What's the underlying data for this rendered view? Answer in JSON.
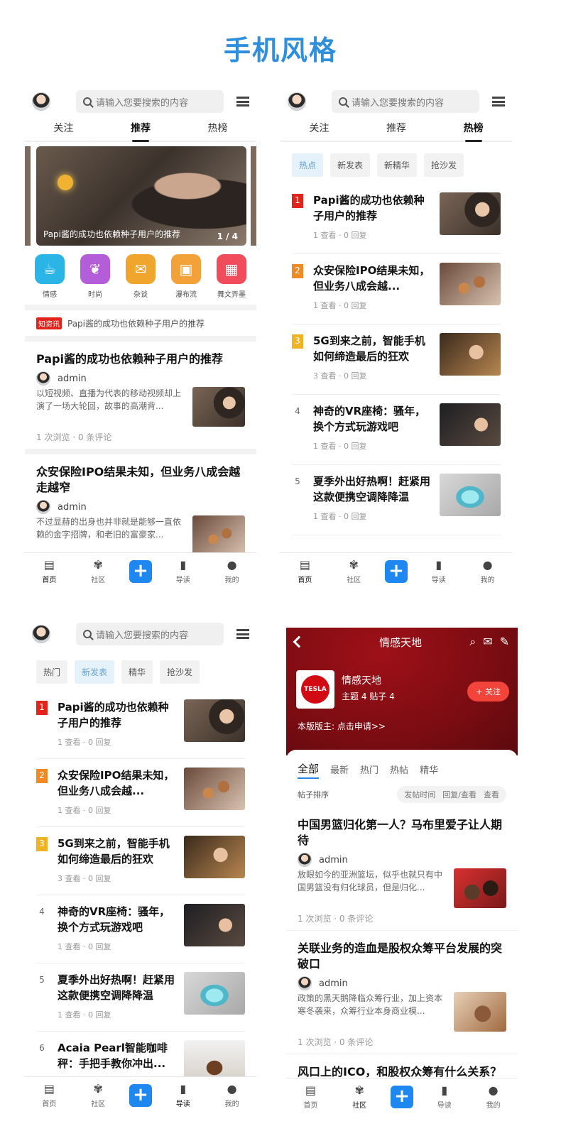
{
  "title": "手机风格",
  "common": {
    "search_placeholder": "请输入您要搜索的内容",
    "tabs": [
      "关注",
      "推荐",
      "热榜"
    ],
    "nav": [
      "首页",
      "社区",
      "导读",
      "我的"
    ],
    "nav_add": "+"
  },
  "phone1": {
    "banner_caption": "Papi酱的成功也依赖种子用户的推荐",
    "banner_page": "1 / 4",
    "categories": [
      "情感",
      "时尚",
      "杂谈",
      "瀑布流",
      "舞文弄墨"
    ],
    "notice_badge": "知资讯",
    "notice_text": "Papi酱的成功也依赖种子用户的推荐",
    "feeds": [
      {
        "title": "Papi酱的成功也依赖种子用户的推荐",
        "author": "admin",
        "excerpt": "以短视频、直播为代表的移动视频却上演了一场大轮回，故事的高潮背...",
        "meta": "1 次浏览 · 0 条评论"
      },
      {
        "title": "众安保险IPO结果未知，但业务八成会越走越窄",
        "author": "admin",
        "excerpt": "不过显赫的出身也并非就是能够一直依赖的金字招牌，和老旧的富豪家...",
        "meta": ""
      }
    ]
  },
  "phone2": {
    "chips": [
      "热点",
      "新发表",
      "新精华",
      "抢沙发"
    ],
    "items": [
      {
        "rank": "1",
        "title": "Papi酱的成功也依赖种子用户的推荐",
        "meta": "1 查看 · 0 回复"
      },
      {
        "rank": "2",
        "title": "众安保险IPO结果未知，但业务八成会越...",
        "meta": "1 查看 · 0 回复"
      },
      {
        "rank": "3",
        "title": "5G到来之前，智能手机如何缔造最后的狂欢",
        "meta": "3 查看 · 0 回复"
      },
      {
        "rank": "4",
        "title": "神奇的VR座椅：骚年，换个方式玩游戏吧",
        "meta": "1 查看 · 0 回复"
      },
      {
        "rank": "5",
        "title": "夏季外出好热啊！赶紧用这款便携空调降降温",
        "meta": "1 查看 · 0 回复"
      }
    ]
  },
  "phone3": {
    "chips": [
      "热门",
      "新发表",
      "精华",
      "抢沙发"
    ],
    "items": [
      {
        "rank": "1",
        "title": "Papi酱的成功也依赖种子用户的推荐",
        "meta": "1 查看 · 0 回复"
      },
      {
        "rank": "2",
        "title": "众安保险IPO结果未知，但业务八成会越...",
        "meta": "1 查看 · 0 回复"
      },
      {
        "rank": "3",
        "title": "5G到来之前，智能手机如何缔造最后的狂欢",
        "meta": "3 查看 · 0 回复"
      },
      {
        "rank": "4",
        "title": "神奇的VR座椅：骚年，换个方式玩游戏吧",
        "meta": "1 查看 · 0 回复"
      },
      {
        "rank": "5",
        "title": "夏季外出好热啊！赶紧用这款便携空调降降温",
        "meta": "1 查看 · 0 回复"
      },
      {
        "rank": "6",
        "title": "Acaia Pearl智能咖啡秤：手把手教你冲出...",
        "meta": ""
      }
    ]
  },
  "phone4": {
    "title": "情感天地",
    "forum_name": "情感天地",
    "forum_stats": "主题 4  贴子 4",
    "follow": "+ 关注",
    "moderator": "本版版主:  点击申请>>",
    "logo_text": "TESLA",
    "tabs": [
      "全部",
      "最新",
      "热门",
      "热帖",
      "精华"
    ],
    "sort_label": "帖子排序",
    "sort_options": [
      "发帖时间",
      "回复/查看",
      "查看"
    ],
    "posts": [
      {
        "title": "中国男篮归化第一人？马布里爱子让人期待",
        "author": "admin",
        "excerpt": "放眼如今的亚洲篮坛，似乎也就只有中国男篮没有归化球员，但是归化...",
        "meta": "1 次浏览 · 0 条评论"
      },
      {
        "title": "关联业务的造血是股权众筹平台发展的突破口",
        "author": "admin",
        "excerpt": "政策的黑天鹅降临众筹行业，加上资本寒冬袭来，众筹行业本身商业模...",
        "meta": "1 次浏览 · 0 条评论"
      },
      {
        "title": "风口上的ICO，和股权众筹有什么关系？",
        "author": "admin",
        "excerpt": "",
        "meta": ""
      }
    ]
  }
}
